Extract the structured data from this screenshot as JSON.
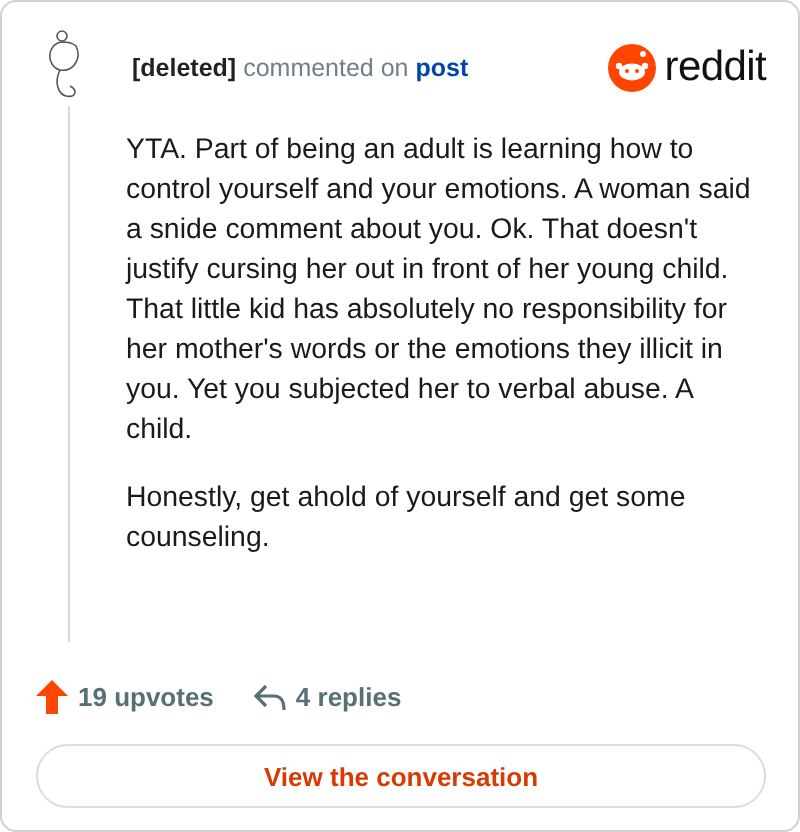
{
  "comment": {
    "author": "[deleted]",
    "action": "commented on",
    "target": "post",
    "paragraphs": [
      "YTA. Part of being an adult is learning how to control yourself and your emotions. A woman said a snide comment about you. Ok. That doesn't justify cursing her out in front of her young child. That little kid has absolutely no responsibility for her mother's words or the emotions they illicit in you. Yet you subjected her to verbal abuse. A child.",
      "Honestly, get ahold of yourself and get some counseling."
    ]
  },
  "brand": {
    "name": "reddit"
  },
  "stats": {
    "upvotes": "19 upvotes",
    "replies": "4 replies"
  },
  "button": {
    "label": "View the conversation"
  }
}
